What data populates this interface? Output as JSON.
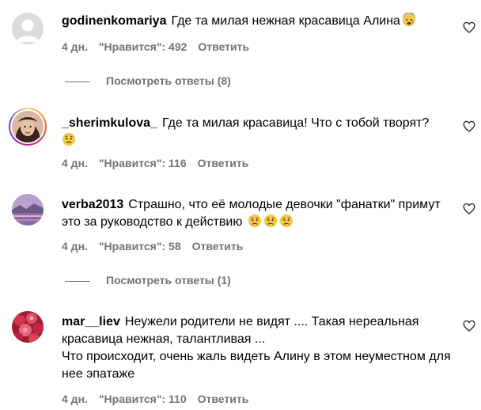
{
  "comments": [
    {
      "username": "godinenkomariya",
      "text": "Где та милая нежная красавица Алина",
      "emojis": [
        "anxious-face-emoji"
      ],
      "time": "4 дн.",
      "likes": "\"Нравится\": 492",
      "reply": "Ответить",
      "view_replies": "Посмотреть ответы (8)",
      "avatar": "default-avatar-icon"
    },
    {
      "username": "_sherimkulova_",
      "text": "Где та милая красавица! Что с тобой творят?",
      "emojis": [
        "sad-face-emoji"
      ],
      "time": "4 дн.",
      "likes": "\"Нравится\": 116",
      "reply": "Ответить",
      "avatar": "profile-photo-with-story-ring"
    },
    {
      "username": "verba2013",
      "text": "Страшно, что её молодые девочки \"фанатки\" примут это за руководство к действию",
      "emojis": [
        "sad-face-emoji",
        "sad-face-emoji",
        "sad-face-emoji"
      ],
      "time": "4 дн.",
      "likes": "\"Нравится\": 58",
      "reply": "Ответить",
      "view_replies": "Посмотреть ответы (1)",
      "avatar": "profile-photo"
    },
    {
      "username": "mar__liev",
      "text": "Неужели родители не видят .... Такая нереальная красавица нежная, талантливая ...",
      "text2": "Что происходит, очень жаль видеть Алину в этом неуместном для нее эпатаже",
      "time": "4 дн.",
      "likes": "\"Нравится\": 110",
      "reply": "Ответить",
      "avatar": "profile-photo"
    }
  ],
  "icons": {
    "like": "heart-icon"
  },
  "colors": {
    "secondary_text": "#737373",
    "text": "#000000",
    "background": "#ffffff"
  }
}
